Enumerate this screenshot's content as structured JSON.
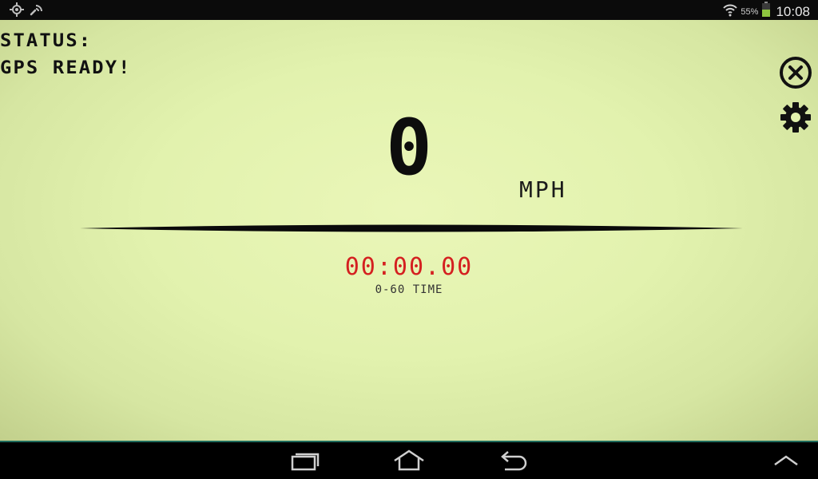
{
  "status_bar": {
    "left_icons": [
      "location-icon",
      "sync-signal-icon"
    ],
    "wifi_icon": "wifi-icon",
    "battery_percent": "55%",
    "battery_icon": "battery-icon",
    "clock": "10:08"
  },
  "lcd": {
    "status_label": "STATUS:",
    "status_value": "GPS READY!",
    "speed": "0",
    "unit": "MPH",
    "timer": "00:00.00",
    "timer_label": "0-60 TIME",
    "close_icon": "close-icon",
    "settings_icon": "gear-icon"
  },
  "nav_bar": {
    "icons": [
      "recent-apps-icon",
      "home-icon",
      "back-icon",
      "chevron-up-icon"
    ]
  },
  "colors": {
    "lcd_background": "#e2f2ae",
    "timer_red": "#d42020",
    "status_bar_bg": "#0b0b0b",
    "accent_teal": "#1f6b5c"
  }
}
